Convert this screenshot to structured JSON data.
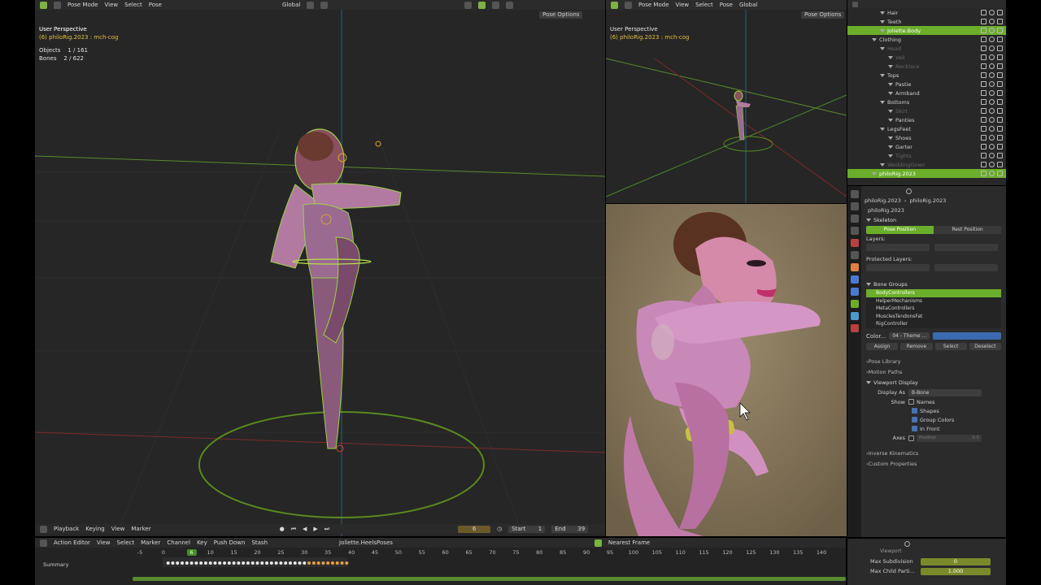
{
  "left_viewport": {
    "header": {
      "mode": "Pose Mode",
      "menus": [
        "View",
        "Select",
        "Pose"
      ],
      "orientation": "Global",
      "options": "Pose Options"
    },
    "overlay": {
      "perspective": "User Perspective",
      "context": "(6) philoRig.2023 : mch-cog",
      "objects_label": "Objects",
      "objects_value": "1 / 161",
      "bones_label": "Bones",
      "bones_value": "2 / 622"
    }
  },
  "right_top_viewport": {
    "header": {
      "mode": "Pose Mode",
      "menus": [
        "View",
        "Select",
        "Pose"
      ],
      "orientation": "Global",
      "options": "Pose Options"
    },
    "overlay": {
      "perspective": "User Perspective",
      "context": "(6) philoRig.2023 : mch-cog"
    }
  },
  "outliner": {
    "rows": [
      {
        "label": "Hair",
        "indent": 3,
        "state": "normal"
      },
      {
        "label": "Teeth",
        "indent": 3,
        "state": "normal"
      },
      {
        "label": "Joliette.Body",
        "indent": 3,
        "state": "highlight"
      },
      {
        "label": "Clothing",
        "indent": 2,
        "state": "normal"
      },
      {
        "label": "Head",
        "indent": 3,
        "state": "dim"
      },
      {
        "label": "Veil",
        "indent": 4,
        "state": "dim"
      },
      {
        "label": "Necklace",
        "indent": 4,
        "state": "dim"
      },
      {
        "label": "Tops",
        "indent": 3,
        "state": "normal"
      },
      {
        "label": "Pastie",
        "indent": 4,
        "state": "normal"
      },
      {
        "label": "Armband",
        "indent": 4,
        "state": "normal"
      },
      {
        "label": "Bottoms",
        "indent": 3,
        "state": "normal"
      },
      {
        "label": "Skirt",
        "indent": 4,
        "state": "dim"
      },
      {
        "label": "Panties",
        "indent": 4,
        "state": "normal"
      },
      {
        "label": "LegsFeet",
        "indent": 3,
        "state": "normal"
      },
      {
        "label": "Shoes",
        "indent": 4,
        "state": "normal"
      },
      {
        "label": "Garter",
        "indent": 4,
        "state": "normal"
      },
      {
        "label": "Tights",
        "indent": 4,
        "state": "dim"
      },
      {
        "label": "WeddingGown",
        "indent": 3,
        "state": "dim"
      },
      {
        "label": "philoRig.2023",
        "indent": 2,
        "state": "highlight"
      }
    ]
  },
  "properties": {
    "breadcrumb_a": "philoRig.2023",
    "breadcrumb_b": "philoRig.2023",
    "object_name": "philoRig.2023",
    "skeleton": {
      "title": "Skeleton",
      "pose_position": "Pose Position",
      "rest_position": "Rest Position",
      "layers": "Layers:",
      "protected_layers": "Protected Layers:"
    },
    "bone_groups": {
      "title": "Bone Groups",
      "items": [
        "BodyControllers",
        "HelperMechanisms",
        "MetaControllers",
        "MusclesTendonsFat",
        "RigController"
      ],
      "color_label": "Color...",
      "theme": "04 - Theme ...",
      "assign": "Assign",
      "remove": "Remove",
      "select": "Select",
      "deselect": "Deselect"
    },
    "sections_closed_a": [
      "Pose Library",
      "Motion Paths"
    ],
    "viewport_display": {
      "title": "Viewport Display",
      "display_as_label": "Display As",
      "display_as_value": "B-Bone",
      "show_label": "Show",
      "names": "Names",
      "shapes": "Shapes",
      "group_colors": "Group Colors",
      "in_front": "In Front",
      "axes_label": "Axes",
      "position_label": "Position",
      "position_value": "0.5"
    },
    "sections_closed_b": [
      "Inverse Kinematics",
      "Custom Properties"
    ]
  },
  "bottom_right": {
    "section": "Viewport",
    "max_subdivision_label": "Max Subdivision",
    "max_subdivision_value": "0",
    "max_child_label": "Max Child Parti...",
    "max_child_value": "1.000"
  },
  "playback_bar": {
    "menus": [
      "Playback",
      "Keying",
      "View",
      "Marker"
    ],
    "current_frame": "6",
    "start_label": "Start",
    "start_value": "1",
    "end_label": "End",
    "end_value": "39"
  },
  "action_editor": {
    "mode": "Action Editor",
    "menus": [
      "View",
      "Select",
      "Marker",
      "Channel",
      "Key"
    ],
    "push_down": "Push Down",
    "stash": "Stash",
    "action_name": "Joliette.HeelsPoses",
    "snap": "Nearest Frame",
    "summary": "Summary",
    "current_frame": "6",
    "ticks": [
      "-5",
      "0",
      "10",
      "15",
      "20",
      "25",
      "30",
      "35",
      "40",
      "45",
      "50",
      "55",
      "60",
      "65",
      "70",
      "75",
      "80",
      "85",
      "90",
      "95",
      "100",
      "105",
      "110",
      "115",
      "120",
      "125",
      "130",
      "135",
      "140"
    ]
  },
  "colors": {
    "accent_green": "#6aae2a",
    "selection_blue": "#4772b3",
    "bone_outline": "#9bd24a"
  }
}
